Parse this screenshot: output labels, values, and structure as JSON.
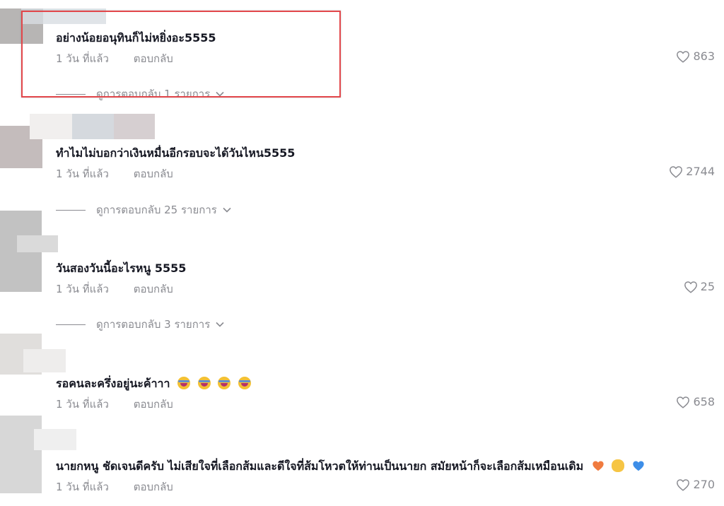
{
  "comments": [
    {
      "text": "อย่างน้อยอนุทินก็ไม่หยิ่งอะ5555",
      "time": "1 วัน ที่แล้ว",
      "reply": "ตอบกลับ",
      "likes": "863",
      "view_replies": "ดูการตอบกลับ 1 รายการ"
    },
    {
      "text": "ทำไมไม่บอกว่าเงินหมื่นอีกรอบจะได้วันไหน5555",
      "time": "1 วัน ที่แล้ว",
      "reply": "ตอบกลับ",
      "likes": "2744",
      "view_replies": "ดูการตอบกลับ 25 รายการ"
    },
    {
      "text": "วันสองวันนี้อะไรหนู 5555",
      "time": "1 วัน ที่แล้ว",
      "reply": "ตอบกลับ",
      "likes": "25",
      "view_replies": "ดูการตอบกลับ 3 รายการ"
    },
    {
      "text": "รอคนละครึ่งอยู่นะค้าาา",
      "time": "1 วัน ที่แล้ว",
      "reply": "ตอบกลับ",
      "likes": "658"
    },
    {
      "text": "นายกหนู ชัดเจนดีครับ ไม่เสียใจที่เลือกส้มและดีใจที่ส้มโหวตให้ท่านเป็นนายก สมัยหน้าก็จะเลือกส้มเหมือนเดิม",
      "time": "1 วัน ที่แล้ว",
      "reply": "ตอบกลับ",
      "likes": "270"
    }
  ],
  "colors": {
    "highlight": "#e2474b",
    "muted": "#8a8b91",
    "text": "#161823"
  },
  "icons": {
    "like": "heart-outline-icon",
    "expand": "chevron-down-icon",
    "emoji_laugh": "laughing-tears-emoji",
    "emoji_heart": "orange-heart-emoji",
    "emoji_hands": "handshake-emoji",
    "emoji_blue": "blue-heart-emoji"
  }
}
